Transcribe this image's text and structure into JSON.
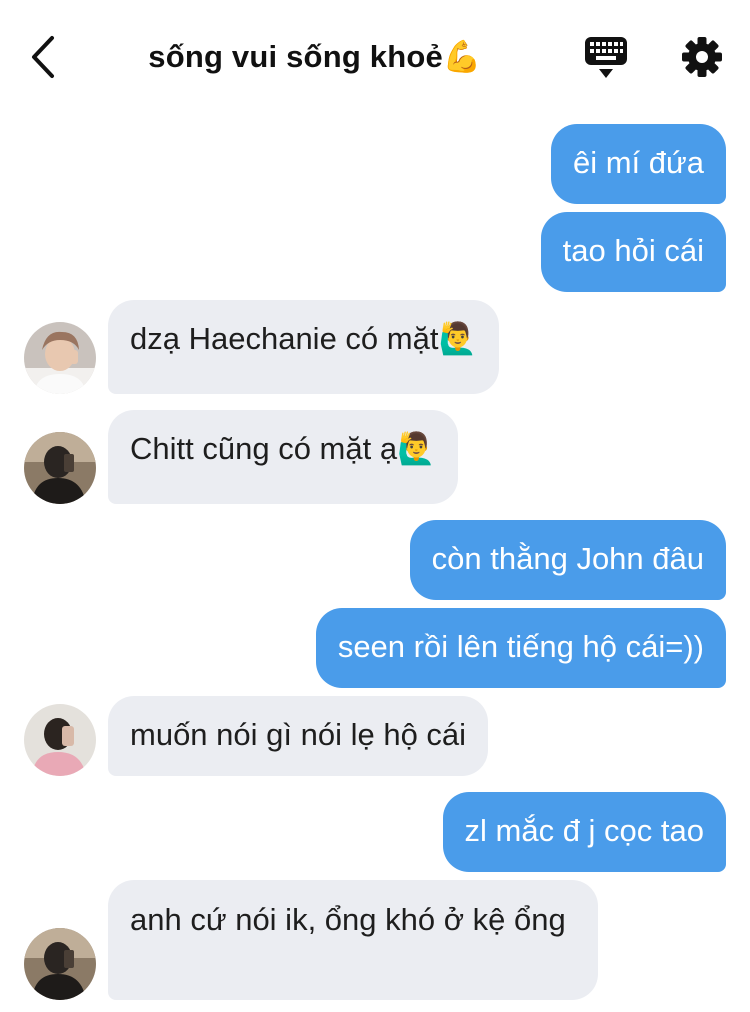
{
  "header": {
    "title": "sống vui sống khoẻ💪"
  },
  "messages": [
    {
      "sender": "me",
      "text": "êi mí đứa"
    },
    {
      "sender": "me",
      "text": "tao hỏi cái"
    },
    {
      "sender": "them",
      "text": "dzạ Haechanie có mặt🙋‍♂️"
    },
    {
      "sender": "them",
      "text": "Chitt cũng có mặt ạ🙋‍♂️"
    },
    {
      "sender": "me",
      "text": "còn thằng John đâu"
    },
    {
      "sender": "me",
      "text": "seen rồi lên tiếng hộ cái=))"
    },
    {
      "sender": "them",
      "text": "muốn nói gì nói lẹ hộ cái"
    },
    {
      "sender": "me",
      "text": "zl mắc đ j cọc tao"
    },
    {
      "sender": "them",
      "text": "anh cứ nói ik, ổng khó ở kệ ổng"
    }
  ],
  "colors": {
    "outgoing_bubble": "#4a9cea",
    "incoming_bubble": "#ebedf2"
  },
  "icons": {
    "back": "chevron-left-icon",
    "keyboard": "keyboard-icon",
    "settings": "gear-icon"
  }
}
